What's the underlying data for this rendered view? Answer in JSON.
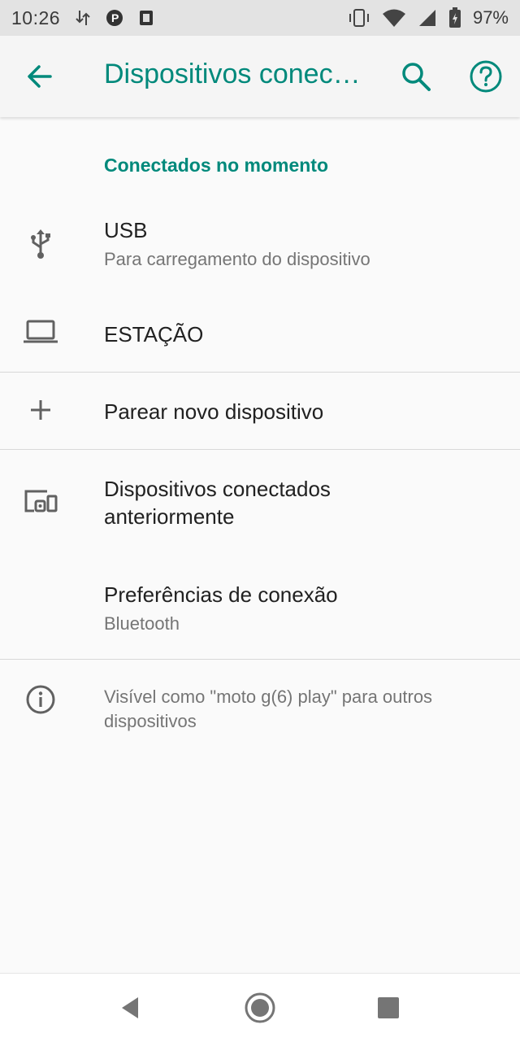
{
  "status_bar": {
    "time": "10:26",
    "battery_percent": "97%",
    "icons_left": [
      "data-transfer-icon",
      "parking-app-icon",
      "notification-app-icon"
    ],
    "icons_right": [
      "vibrate-icon",
      "wifi-icon",
      "cell-signal-icon",
      "battery-charging-icon"
    ]
  },
  "app_bar": {
    "title": "Dispositivos conec…",
    "accent_color": "#00897b"
  },
  "section_header": "Conectados no momento",
  "connected": [
    {
      "icon": "usb-icon",
      "title": "USB",
      "subtitle": "Para carregamento do dispositivo"
    },
    {
      "icon": "laptop-icon",
      "title": "ESTAÇÃO"
    }
  ],
  "pair_new": {
    "icon": "add-icon",
    "title": "Parear novo dispositivo"
  },
  "previous": {
    "icon": "devices-icon",
    "title_line1": "Dispositivos conectados",
    "title_line2": "anteriormente"
  },
  "preferences": {
    "title": "Preferências de conexão",
    "subtitle": "Bluetooth"
  },
  "info": {
    "icon": "info-icon",
    "text": "Visível como \"moto g(6) play\" para outros dispositivos"
  },
  "nav": [
    "back-icon",
    "home-icon",
    "recents-icon"
  ]
}
